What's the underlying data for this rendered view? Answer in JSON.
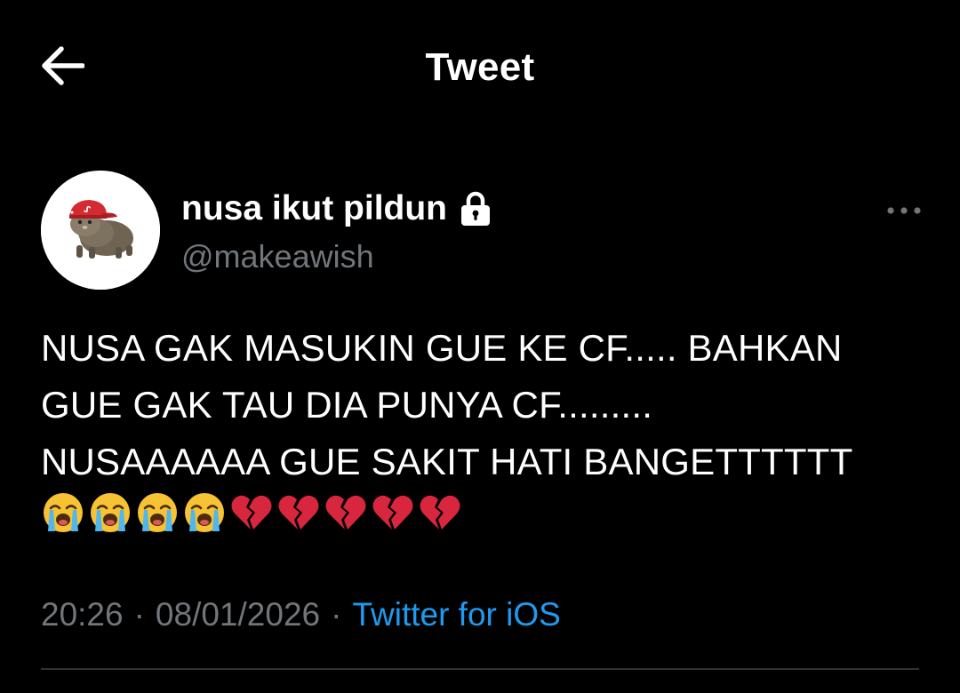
{
  "header": {
    "title": "Tweet",
    "back_icon": "arrow-left-icon"
  },
  "tweet": {
    "author": {
      "display_name": "nusa ikut pildun",
      "handle": "@makeawish",
      "protected_icon": "lock-icon",
      "avatar_icon": "cat-with-red-cap"
    },
    "more_icon": "more-horizontal-icon",
    "text": "NUSA GAK MASUKIN GUE KE CF..... BAHKAN\nGUE GAK TAU DIA PUNYA CF.........\nNUSAAAAAA GUE SAKIT HATI BANGETTTTTT",
    "emojis": [
      "loudly-crying-face",
      "loudly-crying-face",
      "loudly-crying-face",
      "loudly-crying-face",
      "broken-heart",
      "broken-heart",
      "broken-heart",
      "broken-heart",
      "broken-heart"
    ],
    "meta": {
      "time": "20:26",
      "separator": "·",
      "date": "08/01/2026",
      "source": "Twitter for iOS"
    }
  },
  "colors": {
    "background": "#000000",
    "text": "#ffffff",
    "muted": "#71767b",
    "link": "#1d9bf0",
    "divider": "#2f3336",
    "heart": "#d7263d",
    "emoji_face": "#f7c233"
  }
}
